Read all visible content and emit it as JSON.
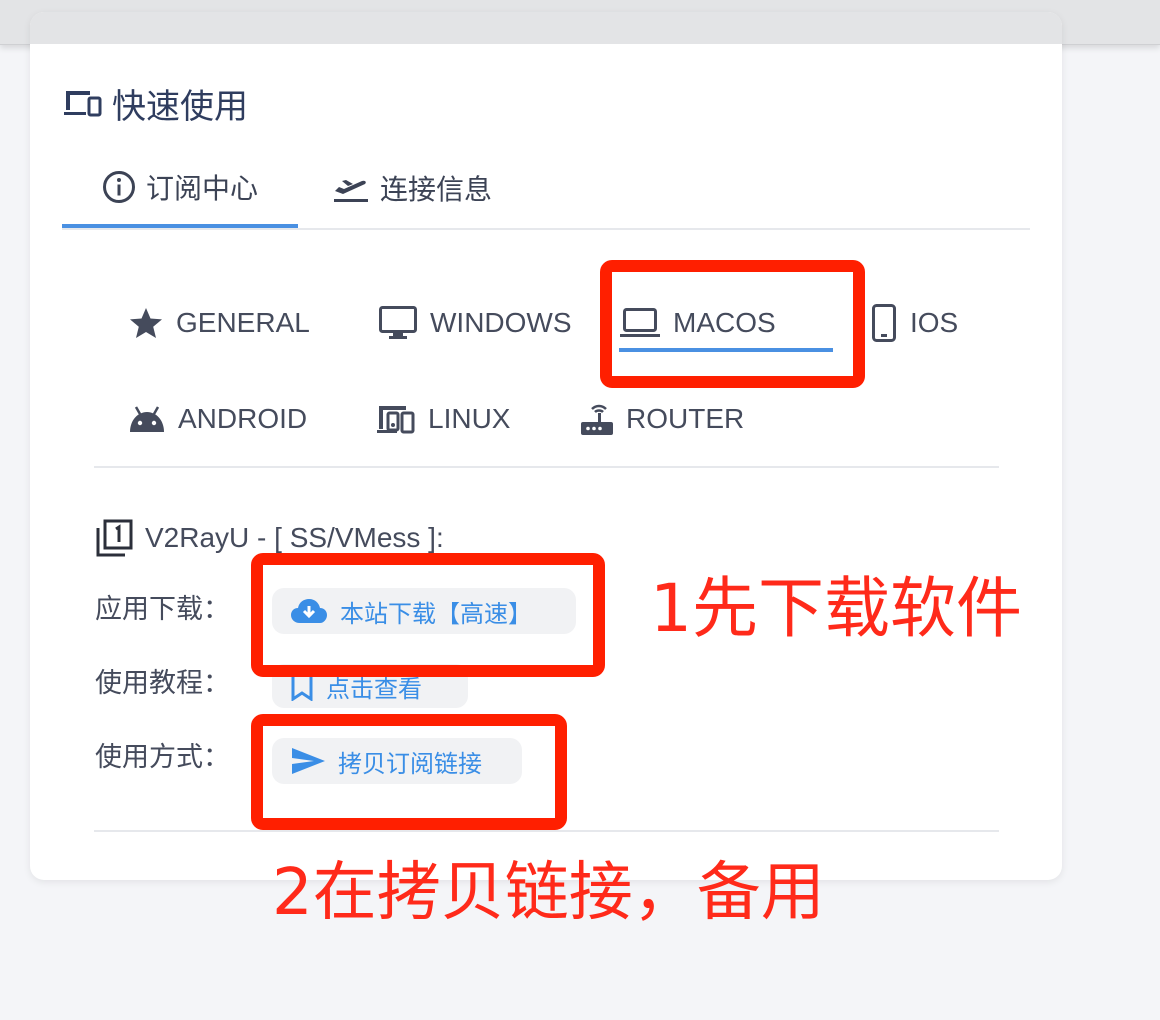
{
  "header": {
    "title": "快速使用",
    "icon": "devices-icon"
  },
  "tabs": [
    {
      "label": "订阅中心",
      "icon": "info-circle-icon",
      "active": true
    },
    {
      "label": "连接信息",
      "icon": "flight-takeoff-icon",
      "active": false
    }
  ],
  "os_tabs": [
    {
      "label": "GENERAL",
      "icon": "star-icon"
    },
    {
      "label": "WINDOWS",
      "icon": "monitor-icon"
    },
    {
      "label": "MACOS",
      "icon": "laptop-icon",
      "active": true
    },
    {
      "label": "IOS",
      "icon": "phone-icon"
    },
    {
      "label": "ANDROID",
      "icon": "android-icon"
    },
    {
      "label": "LINUX",
      "icon": "devices-icon"
    },
    {
      "label": "ROUTER",
      "icon": "router-icon"
    }
  ],
  "app": {
    "title": "V2RayU - [ SS/VMess ]:",
    "title_icon": "filter-1-icon",
    "rows": [
      {
        "label": "应用下载：",
        "button": "本站下载【高速】",
        "icon": "cloud-download-icon"
      },
      {
        "label": "使用教程：",
        "button": "点击查看",
        "icon": "bookmark-icon"
      },
      {
        "label": "使用方式：",
        "button": "拷贝订阅链接",
        "icon": "send-icon"
      }
    ]
  },
  "annotations": {
    "step1": "1先下载软件",
    "step2": "2在拷贝链接，备用"
  },
  "colors": {
    "accent": "#4a90e2",
    "link": "#3a8ee6",
    "annotation_red": "#ff1f00",
    "title": "#2f3d5f"
  }
}
